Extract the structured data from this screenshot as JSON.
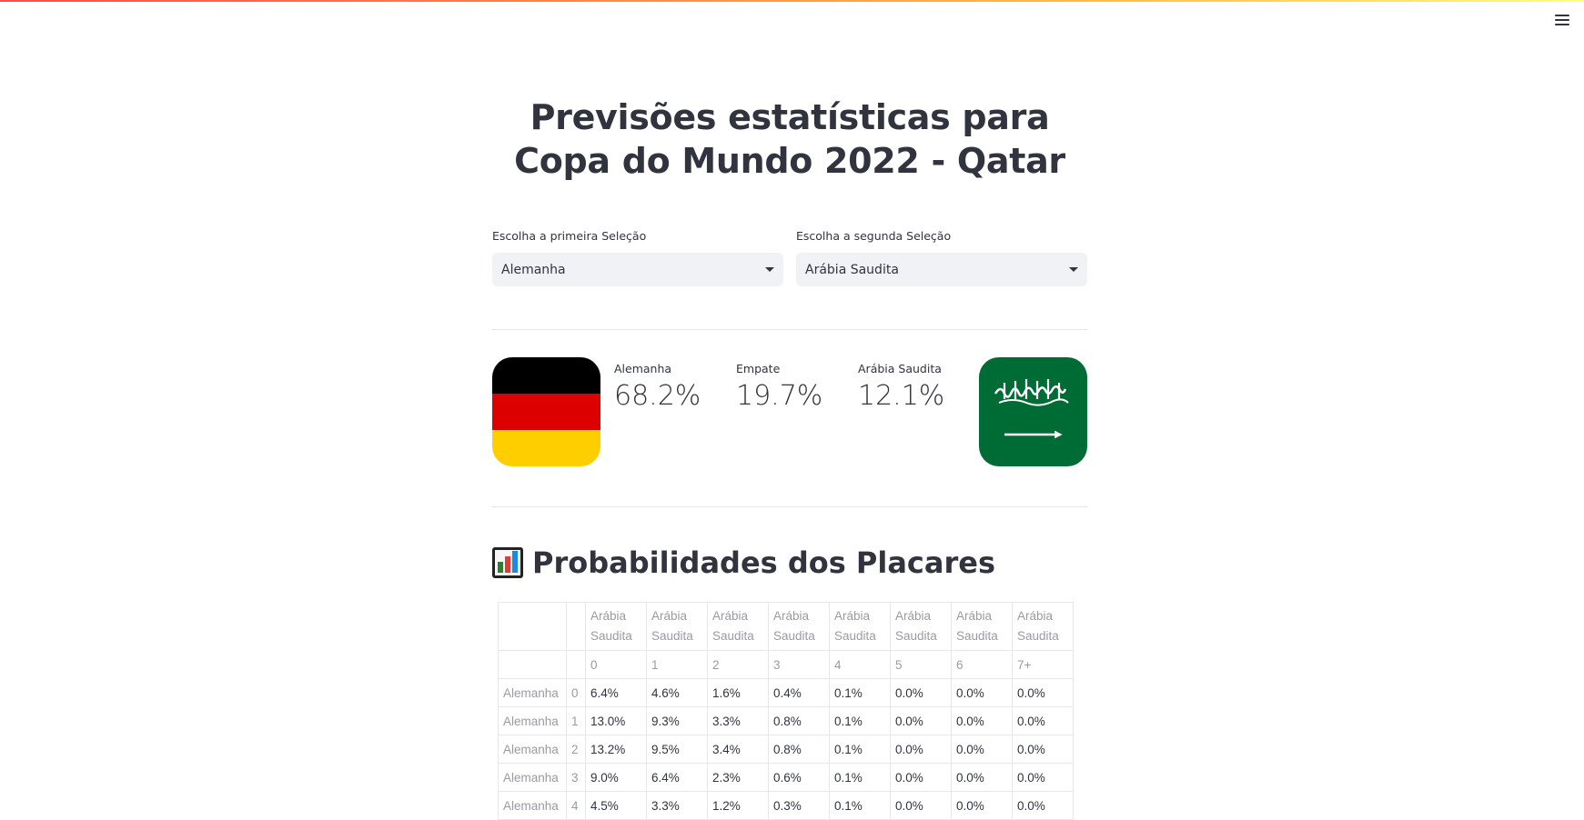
{
  "header": {
    "menu_icon": "hamburger-menu-icon"
  },
  "page": {
    "title": "Previsões estatísticas para Copa do Mundo 2022 - Qatar"
  },
  "selectors": {
    "first": {
      "label": "Escolha a primeira Seleção",
      "value": "Alemanha"
    },
    "second": {
      "label": "Escolha a segunda Seleção",
      "value": "Arábia Saudita"
    }
  },
  "metrics": {
    "team1": {
      "label": "Alemanha",
      "value": "68.2%"
    },
    "draw": {
      "label": "Empate",
      "value": "19.7%"
    },
    "team2": {
      "label": "Arábia Saudita",
      "value": "12.1%"
    }
  },
  "flags": {
    "team1": {
      "name": "germany-flag",
      "colors": [
        "#000000",
        "#dd0000",
        "#ffce00"
      ]
    },
    "team2": {
      "name": "saudi-arabia-flag",
      "color": "#006c35",
      "script_text": "لا إله إلا الله محمد رسول الله"
    }
  },
  "section": {
    "icon": "bar-chart-icon",
    "title": "Probabilidades dos Placares"
  },
  "score_table": {
    "col_team": "Arábia Saudita",
    "col_goals": [
      "0",
      "1",
      "2",
      "3",
      "4",
      "5",
      "6",
      "7+"
    ],
    "rows": [
      {
        "team": "Alemanha",
        "goals": "0",
        "values": [
          "6.4%",
          "4.6%",
          "1.6%",
          "0.4%",
          "0.1%",
          "0.0%",
          "0.0%",
          "0.0%"
        ]
      },
      {
        "team": "Alemanha",
        "goals": "1",
        "values": [
          "13.0%",
          "9.3%",
          "3.3%",
          "0.8%",
          "0.1%",
          "0.0%",
          "0.0%",
          "0.0%"
        ]
      },
      {
        "team": "Alemanha",
        "goals": "2",
        "values": [
          "13.2%",
          "9.5%",
          "3.4%",
          "0.8%",
          "0.1%",
          "0.0%",
          "0.0%",
          "0.0%"
        ]
      },
      {
        "team": "Alemanha",
        "goals": "3",
        "values": [
          "9.0%",
          "6.4%",
          "2.3%",
          "0.6%",
          "0.1%",
          "0.0%",
          "0.0%",
          "0.0%"
        ]
      },
      {
        "team": "Alemanha",
        "goals": "4",
        "values": [
          "4.5%",
          "3.3%",
          "1.2%",
          "0.3%",
          "0.1%",
          "0.0%",
          "0.0%",
          "0.0%"
        ]
      }
    ]
  }
}
